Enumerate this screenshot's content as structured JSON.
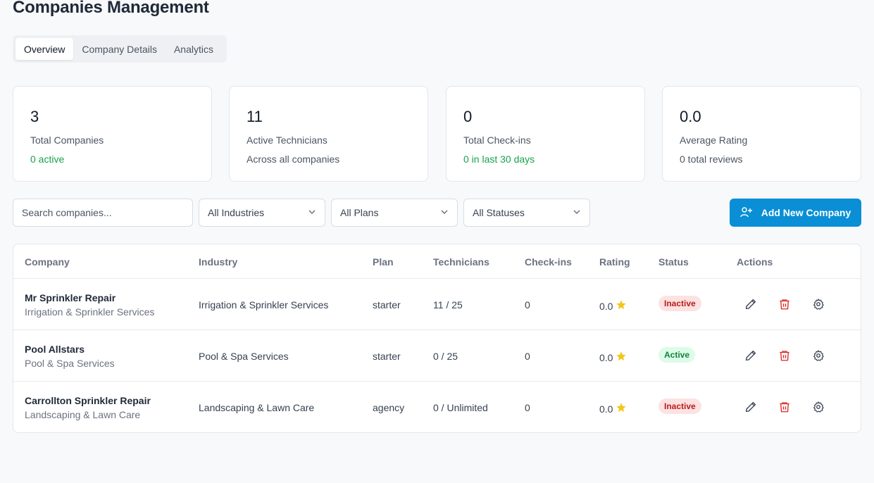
{
  "page": {
    "title": "Companies Management"
  },
  "tabs": [
    {
      "label": "Overview",
      "active": true
    },
    {
      "label": "Company Details",
      "active": false
    },
    {
      "label": "Analytics",
      "active": false
    }
  ],
  "stats": [
    {
      "value": "3",
      "label": "Total Companies",
      "sub": "0 active",
      "sub_color": "#16a34a"
    },
    {
      "value": "11",
      "label": "Active Technicians",
      "sub": "Across all companies",
      "sub_color": "#4b5563"
    },
    {
      "value": "0",
      "label": "Total Check-ins",
      "sub": "0 in last 30 days",
      "sub_color": "#16a34a"
    },
    {
      "value": "0.0",
      "label": "Average Rating",
      "sub": "0 total reviews",
      "sub_color": "#4b5563"
    }
  ],
  "filters": {
    "search_placeholder": "Search companies...",
    "industry": "All Industries",
    "plan": "All Plans",
    "status": "All Statuses",
    "add_button": "Add New Company"
  },
  "table": {
    "headers": [
      "Company",
      "Industry",
      "Plan",
      "Technicians",
      "Check-ins",
      "Rating",
      "Status",
      "Actions"
    ],
    "rows": [
      {
        "name": "Mr Sprinkler Repair",
        "sub": "Irrigation & Sprinkler Services",
        "industry": "Irrigation & Sprinkler Services",
        "plan": "starter",
        "technicians": "11 / 25",
        "checkins": "0",
        "rating": "0.0",
        "status": "Inactive"
      },
      {
        "name": "Pool Allstars",
        "sub": "Pool & Spa Services",
        "industry": "Pool & Spa Services",
        "plan": "starter",
        "technicians": "0 / 25",
        "checkins": "0",
        "rating": "0.0",
        "status": "Active"
      },
      {
        "name": "Carrollton Sprinkler Repair",
        "sub": "Landscaping & Lawn Care",
        "industry": "Landscaping & Lawn Care",
        "plan": "agency",
        "technicians": "0 / Unlimited",
        "checkins": "0",
        "rating": "0.0",
        "status": "Inactive"
      }
    ]
  },
  "colors": {
    "accent": "#0a8fd6",
    "star": "#f5c518",
    "delete": "#dc2626"
  },
  "icons": {
    "chevron": "chevron-down-icon",
    "add_user": "user-plus-icon",
    "edit": "pencil-icon",
    "delete": "trash-icon",
    "settings": "gear-icon",
    "star": "star-icon"
  }
}
